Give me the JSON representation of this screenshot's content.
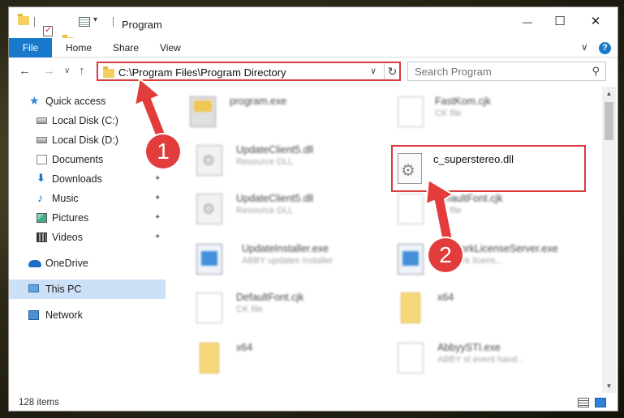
{
  "window": {
    "title": "Program",
    "minimize_glyph": "—",
    "maximize_glyph": "☐",
    "close_glyph": "✕"
  },
  "ribbon": {
    "file_label": "File",
    "home_label": "Home",
    "share_label": "Share",
    "view_label": "View",
    "collapse_glyph": "∨",
    "help_glyph": "?"
  },
  "navigation": {
    "back_glyph": "←",
    "forward_glyph": "→",
    "recent_glyph": "∨",
    "up_glyph": "↑",
    "address_path": "C:\\Program Files\\Program Directory",
    "address_dropdown_glyph": "∨",
    "refresh_glyph": "↻",
    "search_placeholder": "Search Program",
    "search_glyph": "⚲"
  },
  "sidebar": {
    "items": [
      {
        "label": "Quick access",
        "icon": "star-icon"
      },
      {
        "label": "Local Disk (C:)",
        "icon": "drive-icon"
      },
      {
        "label": "Local Disk (D:)",
        "icon": "drive-icon"
      },
      {
        "label": "Documents",
        "icon": "documents-icon"
      },
      {
        "label": "Downloads",
        "icon": "download-icon"
      },
      {
        "label": "Music",
        "icon": "music-icon"
      },
      {
        "label": "Pictures",
        "icon": "pictures-icon"
      },
      {
        "label": "Videos",
        "icon": "videos-icon"
      },
      {
        "label": "OneDrive",
        "icon": "cloud-icon"
      },
      {
        "label": "This PC",
        "icon": "computer-icon"
      },
      {
        "label": "Network",
        "icon": "network-icon"
      }
    ],
    "pin_glyph": "✦"
  },
  "files": [
    {
      "name": "program.exe",
      "type": ""
    },
    {
      "name": "FastKom.cjk",
      "type": "CK file"
    },
    {
      "name": "UpdateClient5.dll",
      "type": "Resource DLL"
    },
    {
      "name": "c_superstereo.dll",
      "type": ""
    },
    {
      "name": "UpdateClient5.dll",
      "type": "Resource DLL"
    },
    {
      "name": "DefaultFont.cjk",
      "type": "CK file"
    },
    {
      "name": "UpdateInstaller.exe",
      "type": "ABBY updates installer"
    },
    {
      "name": "NetworkLicenseServer.exe",
      "type": "Network licens..."
    },
    {
      "name": "DefaultFont.cjk",
      "type": "CK file"
    },
    {
      "name": "x64",
      "type": ""
    },
    {
      "name": "x64",
      "type": ""
    },
    {
      "name": "AbbyySTI.exe",
      "type": "ABBY st event hand..."
    }
  ],
  "status": {
    "item_count": "128 items"
  },
  "annotations": {
    "step1": "1",
    "step2": "2",
    "color": "#e23c3c"
  }
}
